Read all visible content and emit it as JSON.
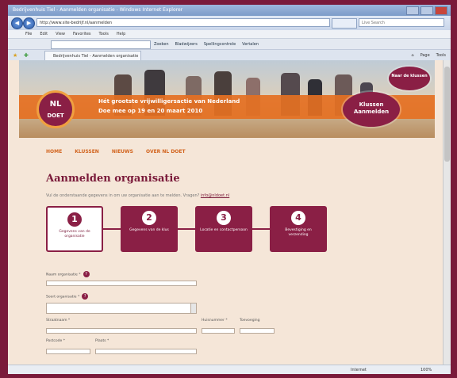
{
  "browser": {
    "title": "Bedrijvenhuis Tiel - Aanmelden organisatie - Windows Internet Explorer",
    "address": "http://www.site-bedrijf.nl/aanmelden",
    "search_placeholder": "Live Search",
    "menu": [
      "File",
      "Edit",
      "View",
      "Favorites",
      "Tools",
      "Help"
    ],
    "toolbar_items": [
      "Zoeken",
      "Bladwijzers",
      "Spellingcontrole",
      "Vertalen"
    ],
    "tab_label": "Bedrijvenhuis Tiel - Aanmelden organisatie",
    "commands": [
      "Page",
      "Tools"
    ],
    "status_zone": "Internet",
    "status_zoom": "100%"
  },
  "site": {
    "logo_line1": "NL",
    "logo_line2": "DOET",
    "banner_line1": "Hét grootste vrijwilligersactie van Nederland",
    "banner_line2": "Doe mee op 19 en 20 maart 2010",
    "oval_top": "Naar de klussen",
    "oval_main_line1": "Klussen",
    "oval_main_line2": "Aanmelden",
    "nav": [
      "HOME",
      "KLUSSEN",
      "NIEUWS",
      "OVER NL DOET"
    ]
  },
  "page": {
    "title": "Aanmelden organisatie",
    "intro": "Vul de onderstaande gegevens in om uw organisatie aan te melden. Vragen?",
    "intro_link": "info@nldoet.nl"
  },
  "steps": [
    {
      "num": "1",
      "label": "Gegevens van de organisatie",
      "active": true
    },
    {
      "num": "2",
      "label": "Gegevens van de klus",
      "active": false
    },
    {
      "num": "3",
      "label": "Locatie en contactpersoon",
      "active": false
    },
    {
      "num": "4",
      "label": "Bevestiging en verzending",
      "active": false
    }
  ],
  "form": {
    "org_name_label": "Naam organisatie *",
    "org_type_label": "Soort organisatie *",
    "street_label": "Straatnaam *",
    "housenr_label": "Huisnummer *",
    "addition_label": "Toevoeging",
    "postcode_label": "Postcode *",
    "city_label": "Plaats *",
    "help_glyph": "?"
  }
}
